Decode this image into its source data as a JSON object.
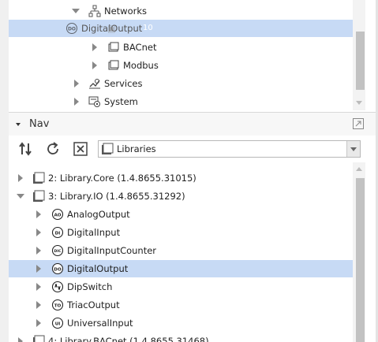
{
  "top_tree": {
    "items": [
      {
        "label": "Networks",
        "icon": "network-icon"
      },
      {
        "label": "DigitalOutput",
        "icon": "digital-output-icon",
        "drag_ghost": "10"
      },
      {
        "label": "BACnet",
        "icon": "folder-icon"
      },
      {
        "label": "Modbus",
        "icon": "folder-icon"
      },
      {
        "label": "Services",
        "icon": "services-icon"
      },
      {
        "label": "System",
        "icon": "system-icon"
      }
    ]
  },
  "nav": {
    "title": "Nav",
    "combo_value": "Libraries",
    "items": [
      {
        "label": "2: Library.Core (1.4.8655.31015)",
        "icon": "library-icon"
      },
      {
        "label": "3: Library.IO (1.4.8655.31292)",
        "icon": "library-icon"
      },
      {
        "label": "AnalogOutput",
        "icon": "ao-icon",
        "badge": "AO"
      },
      {
        "label": "DigitalInput",
        "icon": "di-icon",
        "badge": "DI"
      },
      {
        "label": "DigitalInputCounter",
        "icon": "dic-icon",
        "badge": "DIC"
      },
      {
        "label": "DigitalOutput",
        "icon": "do-icon",
        "badge": "DO"
      },
      {
        "label": "DipSwitch",
        "icon": "dipswitch-icon",
        "badge": "≡"
      },
      {
        "label": "TriacOutput",
        "icon": "to-icon",
        "badge": "TO"
      },
      {
        "label": "UniversalInput",
        "icon": "ui-icon",
        "badge": "UI"
      },
      {
        "label": "4: Library.BACnet (1.4.8655.31468)",
        "icon": "library-icon"
      }
    ]
  },
  "colors": {
    "selection": "#c7daf5",
    "scroll_thumb": "#c2c2c2"
  }
}
